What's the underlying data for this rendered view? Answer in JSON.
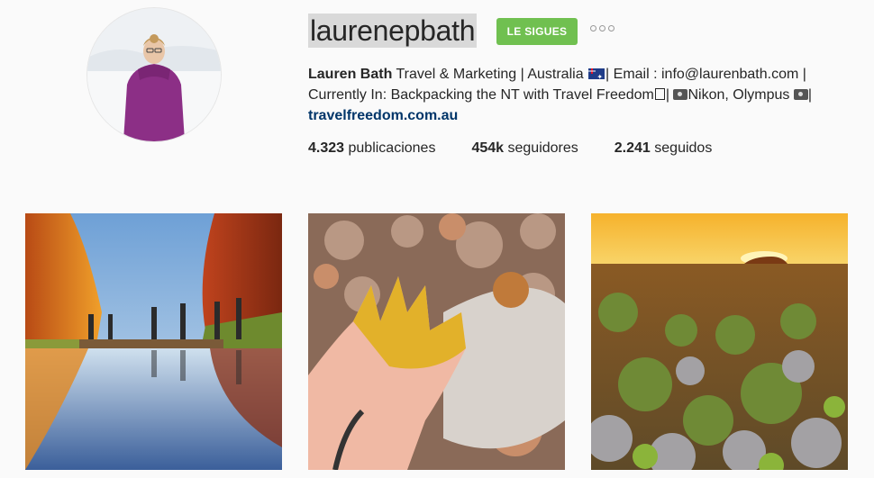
{
  "profile": {
    "username": "laurenepbath",
    "follow_label": "LE SIGUES",
    "more_icon": "more-options-icon",
    "bio": {
      "name": "Lauren Bath",
      "line1_rest": "Travel & Marketing | Australia",
      "line1_after_flag": "| Email : info@laurenbath.com |",
      "line2_a": "Currently In: Backpacking the NT with Travel Freedom",
      "line2_b": "|",
      "line2_c": "Nikon, Olympus",
      "line2_d": "|",
      "link": "travelfreedom.com.au"
    },
    "stats": [
      {
        "value": "4.323",
        "label": "publicaciones"
      },
      {
        "value": "454k",
        "label": "seguidores"
      },
      {
        "value": "2.241",
        "label": "seguidos"
      }
    ]
  },
  "posts": [
    {
      "name": "gorge reflection with hikers"
    },
    {
      "name": "hand covered in yellow ochre"
    },
    {
      "name": "outback sunset over Uluru"
    }
  ]
}
